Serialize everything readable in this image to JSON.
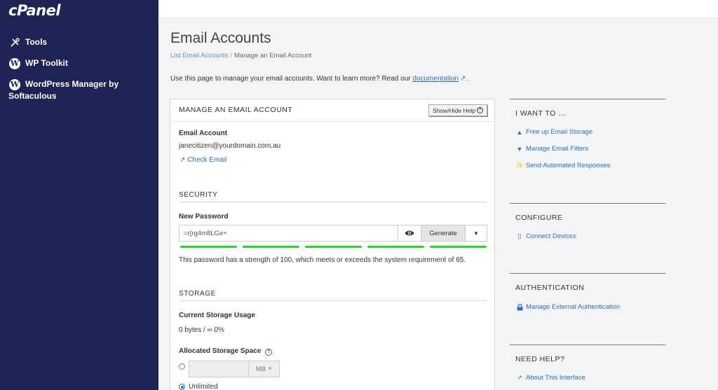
{
  "sidebar": {
    "logo": "cPanel",
    "items": [
      {
        "label": "Tools",
        "icon": "tools-icon"
      },
      {
        "label": "WP Toolkit",
        "icon": "wordpress-icon"
      },
      {
        "label": "WordPress Manager by Softaculous",
        "icon": "wordpress-icon"
      }
    ]
  },
  "page": {
    "title": "Email Accounts",
    "breadcrumb": {
      "link": "List Email Accounts",
      "separator": "/",
      "current": "Manage an Email Account"
    },
    "intro_text": "Use this page to manage your email accounts. Want to learn more? Read our",
    "intro_link": "documentation",
    "intro_end": "."
  },
  "panel": {
    "title": "MANAGE AN EMAIL ACCOUNT",
    "help_button": "Show/Hide Help",
    "email_label": "Email Account",
    "email_value": "janecitizen@yourdomain.com.au",
    "check_email": "Check Email",
    "security": {
      "title": "SECURITY",
      "password_label": "New Password",
      "password_value": "=r[rg4m8LGe+",
      "generate": "Generate",
      "strength_segments": 5,
      "strength_color": "#22d927",
      "strength_text": "This password has a strength of 100, which meets or exceeds the system requirement of 65."
    },
    "storage": {
      "title": "STORAGE",
      "usage_label": "Current Storage Usage",
      "usage_value": "0 bytes / ∞ 0%",
      "allocated_label": "Allocated Storage Space",
      "unit": "MB",
      "unlimited_label": "Unlimited"
    }
  },
  "right": {
    "want_to": {
      "title": "I WANT TO ...",
      "links": [
        "Free up Email Storage",
        "Manage Email Filters",
        "Send Automated Responses"
      ]
    },
    "configure": {
      "title": "CONFIGURE",
      "links": [
        "Connect Devices"
      ]
    },
    "authentication": {
      "title": "AUTHENTICATION",
      "links": [
        "Manage External Authentication"
      ]
    },
    "help": {
      "title": "NEED HELP?",
      "links": [
        "About This Interface"
      ]
    }
  },
  "colors": {
    "sidebar": "#1f2454",
    "link": "#2e6fb7",
    "strength": "#22d927"
  }
}
